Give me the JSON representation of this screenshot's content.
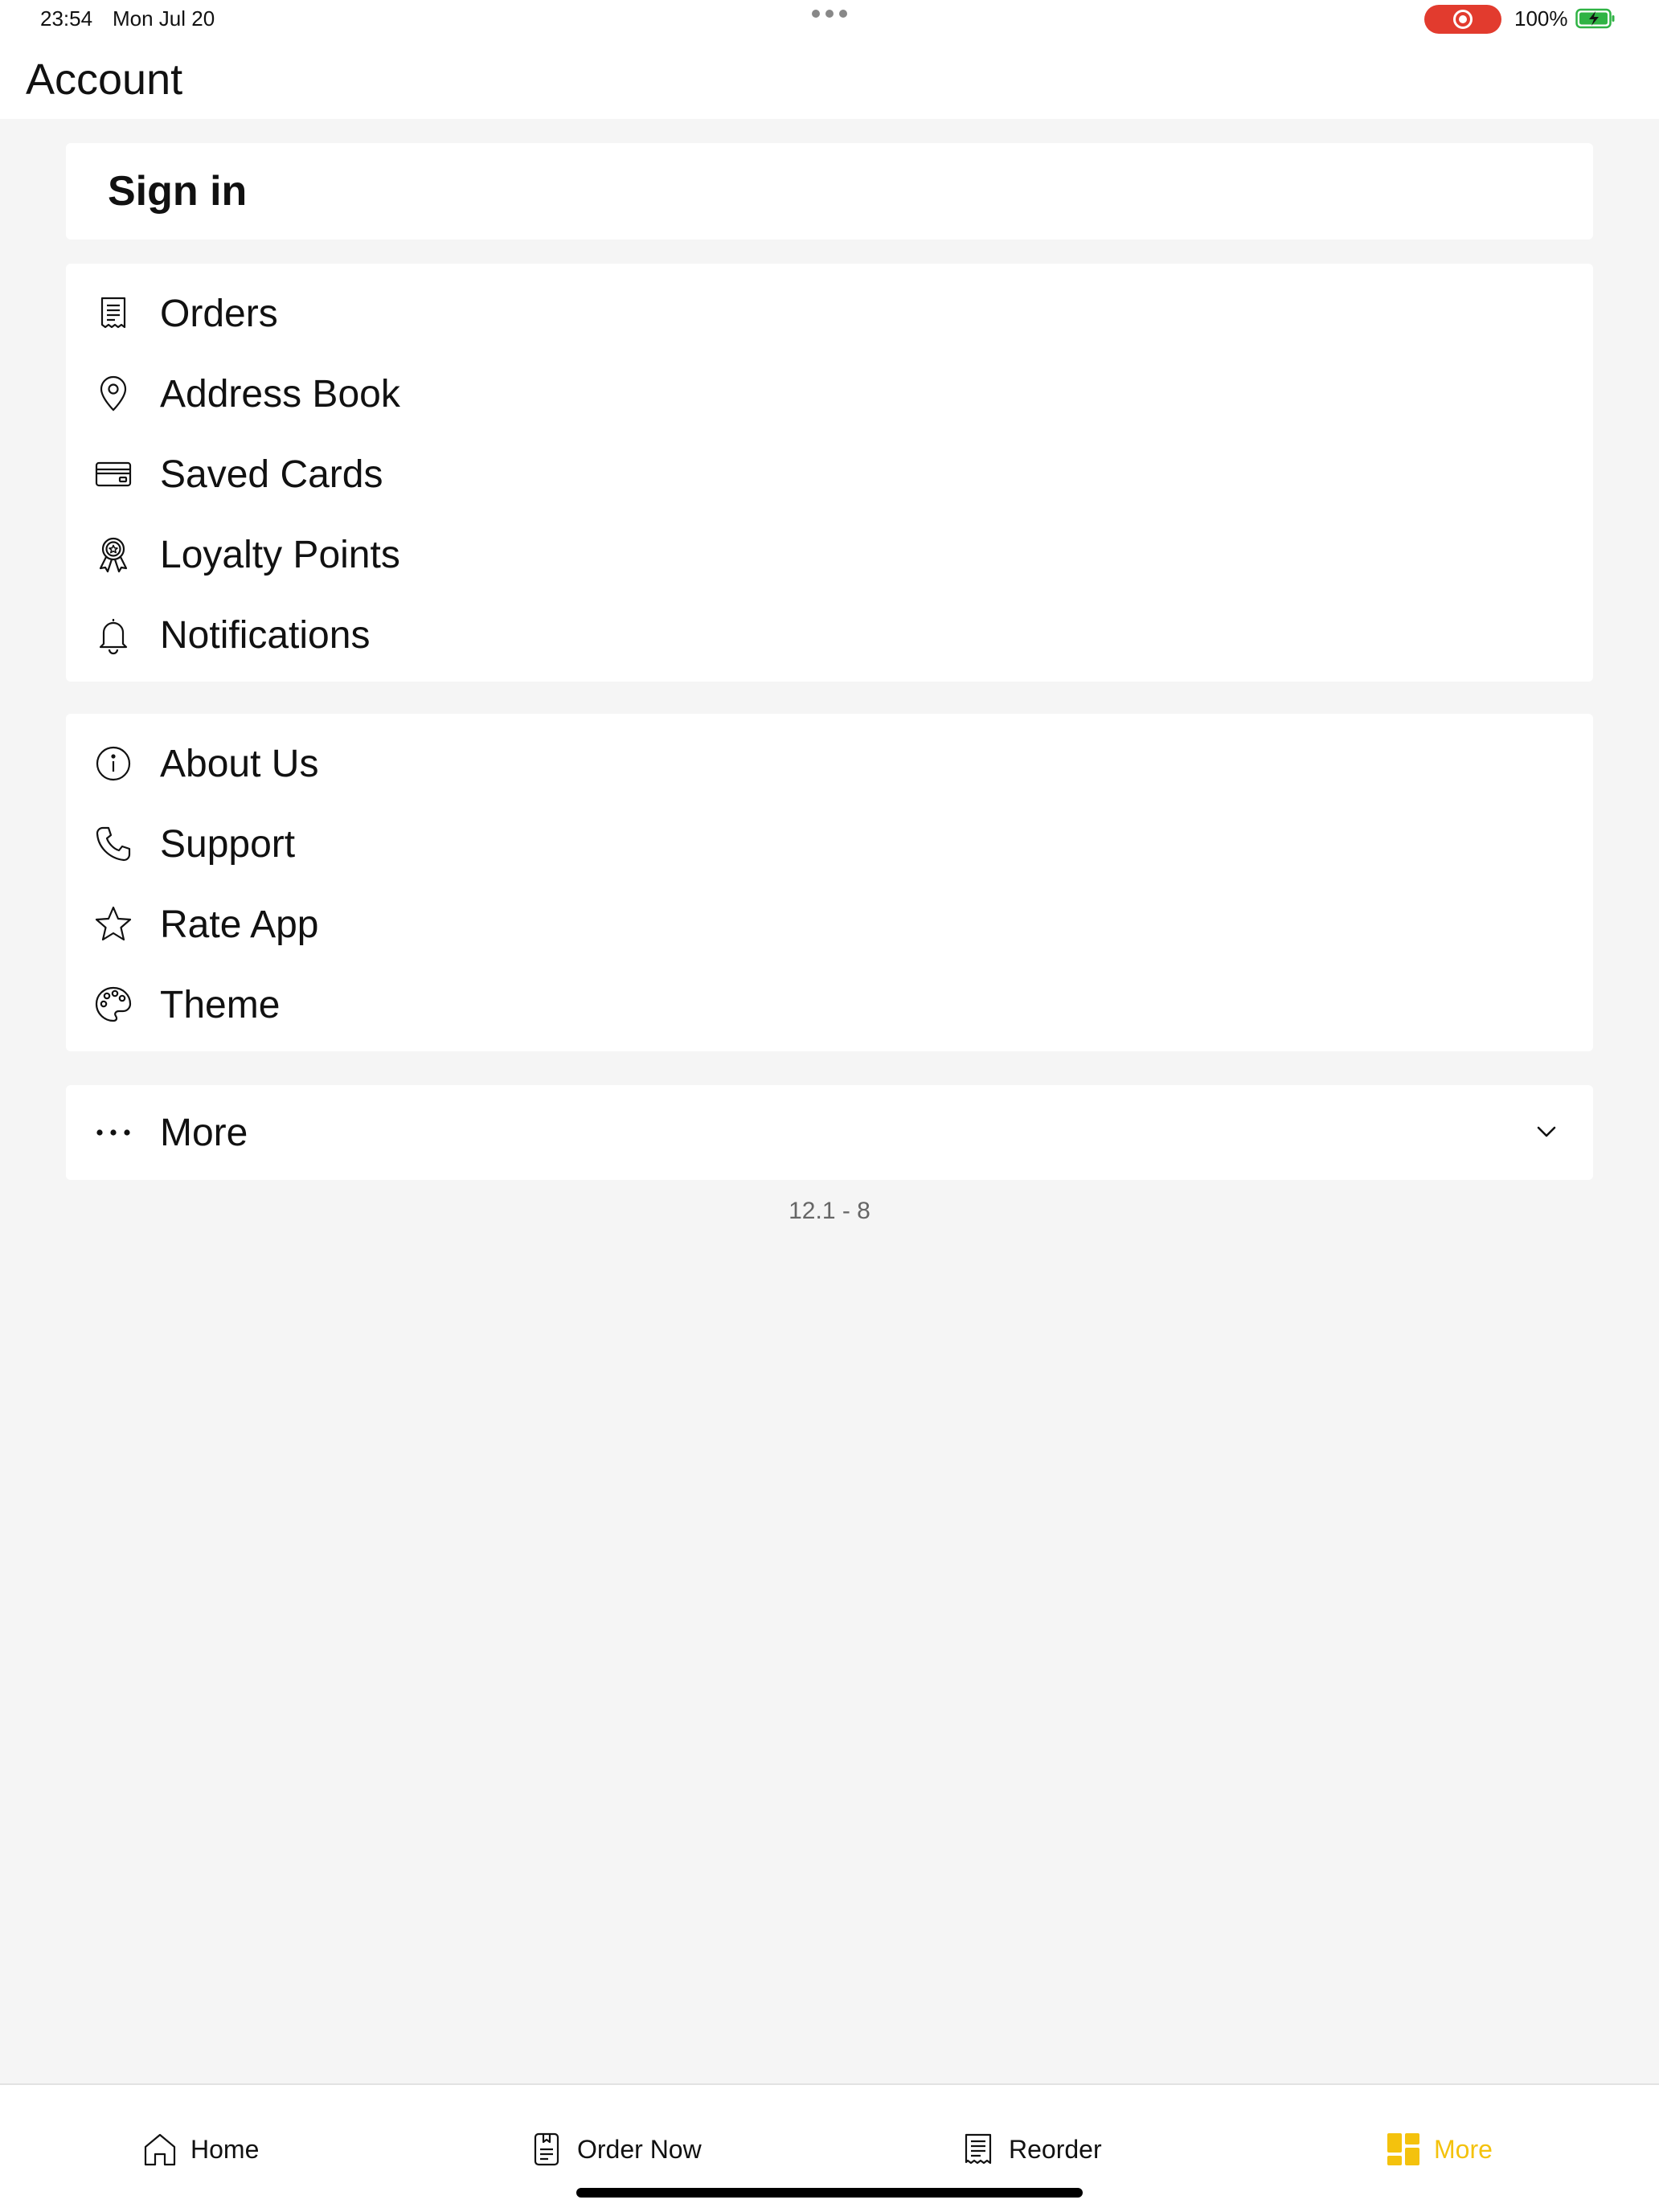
{
  "status_bar": {
    "time": "23:54",
    "date": "Mon Jul 20",
    "battery": "100%",
    "recording_color": "#e23b2e"
  },
  "header": {
    "title": "Account"
  },
  "sign_in": {
    "label": "Sign in"
  },
  "menu_group_1": [
    {
      "label": "Orders",
      "icon": "receipt-icon"
    },
    {
      "label": "Address Book",
      "icon": "location-pin-icon"
    },
    {
      "label": "Saved Cards",
      "icon": "credit-card-icon"
    },
    {
      "label": "Loyalty Points",
      "icon": "award-ribbon-icon"
    },
    {
      "label": "Notifications",
      "icon": "bell-icon"
    }
  ],
  "menu_group_2": [
    {
      "label": "About Us",
      "icon": "info-icon"
    },
    {
      "label": "Support",
      "icon": "phone-icon"
    },
    {
      "label": "Rate App",
      "icon": "star-icon"
    },
    {
      "label": "Theme",
      "icon": "palette-icon"
    }
  ],
  "more_row": {
    "label": "More",
    "icon": "ellipsis-icon",
    "expand_icon": "chevron-down-icon"
  },
  "version": "12.1 - 8",
  "tab_bar": {
    "active_color": "#f4c20d",
    "tabs": [
      {
        "label": "Home",
        "icon": "home-icon",
        "active": false
      },
      {
        "label": "Order Now",
        "icon": "order-menu-icon",
        "active": false
      },
      {
        "label": "Reorder",
        "icon": "receipt-icon",
        "active": false
      },
      {
        "label": "More",
        "icon": "grid-icon",
        "active": true
      }
    ]
  }
}
